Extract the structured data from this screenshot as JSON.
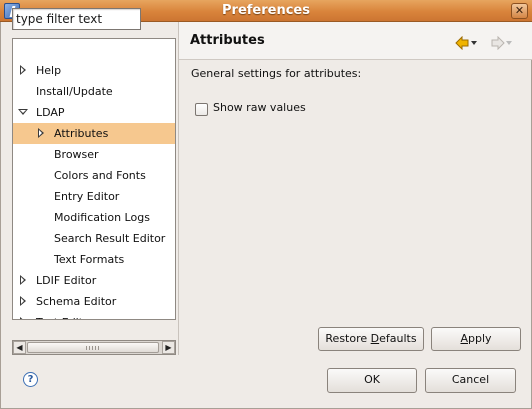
{
  "window": {
    "title": "Preferences",
    "close_glyph": "✕"
  },
  "filter": {
    "value": "type filter text"
  },
  "tree": {
    "items": [
      {
        "label": "Help",
        "state": "closed",
        "level": 0
      },
      {
        "label": "Install/Update",
        "state": "none",
        "level": 0
      },
      {
        "label": "LDAP",
        "state": "open",
        "level": 0
      },
      {
        "label": "Attributes",
        "state": "closed",
        "level": 1,
        "selected": true
      },
      {
        "label": "Browser",
        "state": "none",
        "level": 1
      },
      {
        "label": "Colors and Fonts",
        "state": "none",
        "level": 1
      },
      {
        "label": "Entry Editor",
        "state": "none",
        "level": 1
      },
      {
        "label": "Modification Logs",
        "state": "none",
        "level": 1
      },
      {
        "label": "Search Result Editor",
        "state": "none",
        "level": 1
      },
      {
        "label": "Text Formats",
        "state": "none",
        "level": 1
      },
      {
        "label": "LDIF Editor",
        "state": "closed",
        "level": 0
      },
      {
        "label": "Schema Editor",
        "state": "closed",
        "level": 0
      },
      {
        "label": "Text Editors",
        "state": "closed",
        "level": 0
      }
    ]
  },
  "scrollbar": {
    "left_glyph": "◀",
    "right_glyph": "▶"
  },
  "page": {
    "title": "Attributes",
    "description": "General settings for attributes:",
    "checkbox_label": "Show raw values",
    "checkbox_checked": false
  },
  "buttons": {
    "restore_pre": "Restore ",
    "restore_acc": "D",
    "restore_post": "efaults",
    "apply_acc": "A",
    "apply_post": "pply",
    "ok": "OK",
    "cancel": "Cancel"
  },
  "help": {
    "glyph": "?"
  },
  "colors": {
    "selection": "#f6c88f",
    "titlebar": "#d9843b",
    "back_arrow": "#f0b400"
  }
}
